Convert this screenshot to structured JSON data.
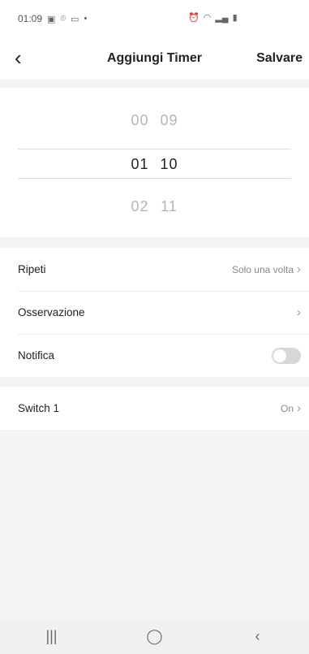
{
  "status_bar": {
    "time": "01:09",
    "left_icons": [
      "image-icon",
      "location-icon",
      "message-icon",
      "dot-icon"
    ],
    "right_icons": [
      "alarm-icon",
      "wifi-icon",
      "signal-icon",
      "battery-icon"
    ]
  },
  "header": {
    "back_icon": "chevron-left-icon",
    "title": "Aggiungi Timer",
    "save_label": "Salvare"
  },
  "time_picker": {
    "rows": [
      {
        "hour": "00",
        "minute": "09",
        "selected": false
      },
      {
        "hour": "01",
        "minute": "10",
        "selected": true
      },
      {
        "hour": "02",
        "minute": "11",
        "selected": false
      }
    ]
  },
  "settings": {
    "repeat": {
      "label": "Ripeti",
      "value": "Solo una volta"
    },
    "note": {
      "label": "Osservazione",
      "value": ""
    },
    "notification": {
      "label": "Notifica",
      "enabled": false
    }
  },
  "actions": {
    "switch1": {
      "label": "Switch 1",
      "value": "On"
    }
  },
  "navbar": {
    "recent": "|||",
    "home": "◯",
    "back": "‹"
  }
}
